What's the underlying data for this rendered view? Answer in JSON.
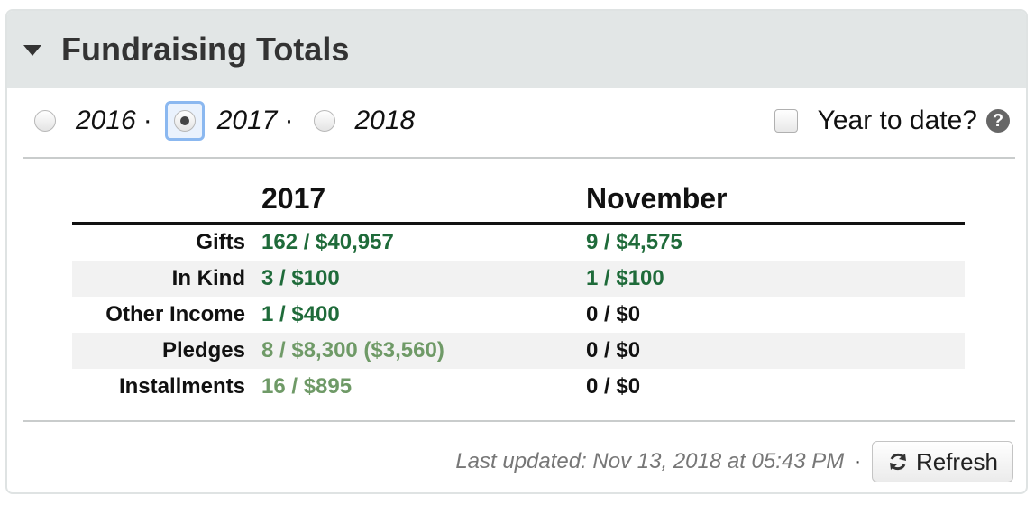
{
  "panel": {
    "title": "Fundraising Totals",
    "collapse_icon": "caret-down-icon"
  },
  "filters": {
    "years": [
      {
        "label": "2016",
        "checked": false
      },
      {
        "label": "2017",
        "checked": true
      },
      {
        "label": "2018",
        "checked": false
      }
    ],
    "separator": "·",
    "ytd_label": "Year to date?",
    "ytd_checked": false,
    "help_icon": "question-circle-icon",
    "help_glyph": "?"
  },
  "totals": {
    "column_headers": [
      "2017",
      "November"
    ],
    "rows": [
      {
        "label": "Gifts",
        "col1": "162 / $40,957",
        "col2": "9 / $4,575"
      },
      {
        "label": "In Kind",
        "col1": "3 / $100",
        "col2": "1 / $100"
      },
      {
        "label": "Other Income",
        "col1": "1 / $400",
        "col2": "0 / $0"
      },
      {
        "label": "Pledges",
        "col1": "8 / $8,300 ($3,560)",
        "col2": "0 / $0"
      },
      {
        "label": "Installments",
        "col1": "16 / $895",
        "col2": "0 / $0"
      }
    ]
  },
  "footer": {
    "last_updated": "Last updated: Nov 13, 2018 at 05:43 PM",
    "separator": "·",
    "refresh_label": "Refresh",
    "refresh_icon": "refresh-icon"
  },
  "colors": {
    "header_bg": "#e2e6e6",
    "value_green": "#1f6b3a",
    "value_pale_green": "#6f9a67",
    "focus_ring": "#8bb8f0"
  }
}
